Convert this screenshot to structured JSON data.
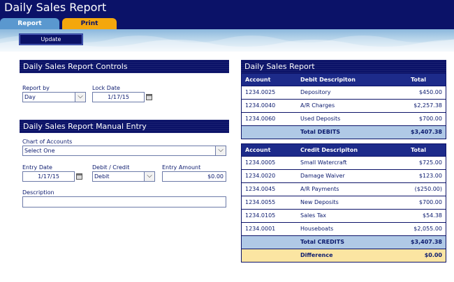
{
  "app": {
    "title": "Daily Sales Report"
  },
  "tabs": [
    {
      "label": "Report",
      "active": true
    },
    {
      "label": "Print",
      "active": false
    }
  ],
  "toolbar": {
    "update_label": "Update"
  },
  "controls": {
    "title": "Daily Sales Report Controls",
    "report_by_label": "Report by",
    "report_by_value": "Day",
    "lock_date_label": "Lock Date",
    "lock_date_value": "1/17/15"
  },
  "manual_entry": {
    "title": "Daily Sales Report Manual Entry",
    "chart_label": "Chart of Accounts",
    "chart_value": "Select One",
    "entry_date_label": "Entry Date",
    "entry_date_value": "1/17/15",
    "debit_credit_label": "Debit / Credit",
    "debit_credit_value": "Debit",
    "entry_amount_label": "Entry Amount",
    "entry_amount_value": "$0.00",
    "description_label": "Description",
    "description_value": ""
  },
  "report": {
    "title": "Daily Sales Report",
    "debits": {
      "headers": {
        "account": "Account",
        "description": "Debit Descripiton",
        "total": "Total"
      },
      "rows": [
        {
          "account": "1234.0025",
          "description": "Depository",
          "total": "$450.00"
        },
        {
          "account": "1234.0040",
          "description": "A/R Charges",
          "total": "$2,257.38"
        },
        {
          "account": "1234.0060",
          "description": "Used Deposits",
          "total": "$700.00"
        }
      ],
      "total_label": "Total DEBITS",
      "total_value": "$3,407.38"
    },
    "credits": {
      "headers": {
        "account": "Account",
        "description": "Credit Descripiton",
        "total": "Total"
      },
      "rows": [
        {
          "account": "1234.0005",
          "description": "Small Watercraft",
          "total": "$725.00"
        },
        {
          "account": "1234.0020",
          "description": "Damage Waiver",
          "total": "$123.00"
        },
        {
          "account": "1234.0045",
          "description": "A/R Payments",
          "total": "($250.00)"
        },
        {
          "account": "1234.0055",
          "description": "New Deposits",
          "total": "$700.00"
        },
        {
          "account": "1234.0105",
          "description": "Sales Tax",
          "total": "$54.38"
        },
        {
          "account": "1234.0001",
          "description": "Houseboats",
          "total": "$2,055.00"
        }
      ],
      "total_label": "Total CREDITS",
      "total_value": "$3,407.38"
    },
    "difference_label": "Difference",
    "difference_value": "$0.00"
  },
  "icons": {
    "dropdown": "chevron-down-icon",
    "calendar": "calendar-icon"
  },
  "colors": {
    "navy": "#0b1268",
    "tab_active": "#5a98cf",
    "tab_print": "#f4a70d",
    "total_row": "#b0c9e6",
    "difference_row": "#fbe5a2"
  }
}
